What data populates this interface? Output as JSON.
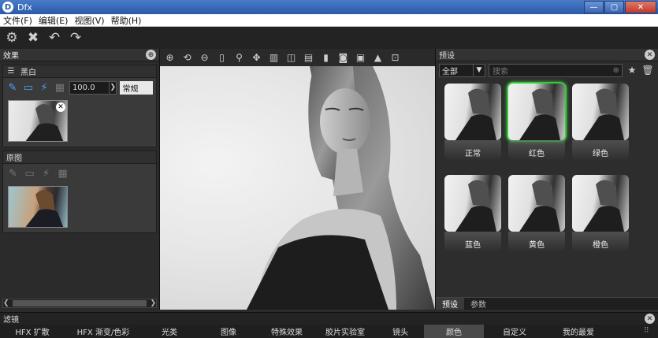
{
  "window": {
    "title": "Dfx",
    "min": "—",
    "max": "▢",
    "close": "✕"
  },
  "menu": [
    "文件(F)",
    "编辑(E)",
    "视图(V)",
    "帮助(H)"
  ],
  "effects_panel": {
    "title": "效果",
    "layers": [
      {
        "name": "黑白",
        "value": "100.0",
        "mode": "常规",
        "thumb": "bw"
      },
      {
        "name": "原图",
        "thumb": "color"
      }
    ]
  },
  "presets_panel": {
    "title": "预设",
    "category": "全部",
    "search_placeholder": "搜索",
    "items": [
      {
        "label": "正常",
        "selected": false
      },
      {
        "label": "红色",
        "selected": true
      },
      {
        "label": "绿色",
        "selected": false
      },
      {
        "label": "蓝色",
        "selected": false
      },
      {
        "label": "黄色",
        "selected": false
      },
      {
        "label": "橙色",
        "selected": false
      }
    ],
    "tabs": [
      {
        "label": "预设",
        "active": true
      },
      {
        "label": "参数",
        "active": false
      }
    ]
  },
  "filters": {
    "title": "滤镜",
    "tabs": [
      {
        "label": "HFX 扩散",
        "active": false
      },
      {
        "label": "HFX 渐变/色彩",
        "active": false
      },
      {
        "label": "光类",
        "active": false
      },
      {
        "label": "图像",
        "active": false
      },
      {
        "label": "特殊效果",
        "active": false
      },
      {
        "label": "胶片实验室",
        "active": false
      },
      {
        "label": "镜头",
        "active": false
      },
      {
        "label": "颜色",
        "active": true
      },
      {
        "label": "自定义",
        "active": false
      },
      {
        "label": "我的最爱",
        "active": false
      }
    ]
  },
  "colors": {
    "accent_selected": "#36c93a",
    "titlebar": "#2a5aa8"
  }
}
